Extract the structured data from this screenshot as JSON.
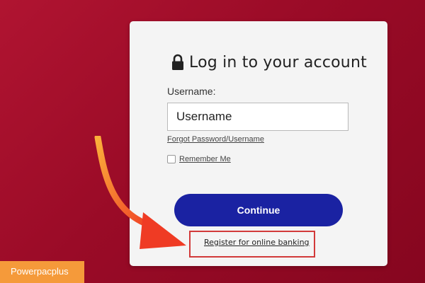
{
  "login": {
    "title": "Log in to your account",
    "username_label": "Username:",
    "username_placeholder": "Username",
    "forgot_link": "Forgot Password/Username",
    "remember_label": "Remember Me",
    "continue_label": "Continue",
    "register_link": "Register for online banking"
  },
  "overlay": {
    "brand_label": "Powerpacplus",
    "arrow_icon": "curved-arrow-icon"
  },
  "colors": {
    "background": "#9a0b27",
    "button": "#1a22a2",
    "highlight_box": "#d23a3a",
    "arrow": "#f26a2e",
    "badge": "#f59a3a"
  }
}
